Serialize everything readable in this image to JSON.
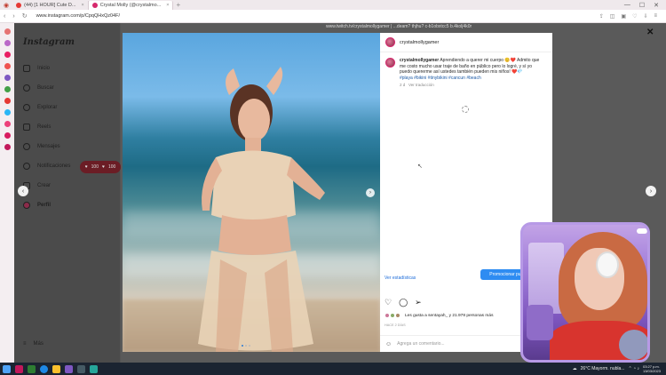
{
  "browser": {
    "tabs": [
      {
        "label": "(44) [1 HOUR] Cute D...",
        "active": false,
        "favicon_color": "#e53935"
      },
      {
        "label": "Crystal Molly (@crystalmo...",
        "active": true,
        "favicon_color": "#d6296d"
      }
    ],
    "url": "www.instagram.com/p/CpqQHxQz04F/",
    "background_text": "www.twitch.tv/crystalmollygamer | ...deam? thjhu? c-b1obxtcc5 b.4kolj4k0r"
  },
  "sidebar": {
    "logo": "Instagram",
    "items": [
      {
        "label": "Inicio",
        "icon": "home-icon",
        "bold": false
      },
      {
        "label": "Buscar",
        "icon": "search-icon",
        "bold": false
      },
      {
        "label": "Explorar",
        "icon": "compass-icon",
        "bold": false
      },
      {
        "label": "Reels",
        "icon": "reels-icon",
        "bold": false
      },
      {
        "label": "Mensajes",
        "icon": "messenger-icon",
        "bold": false
      },
      {
        "label": "Notificaciones",
        "icon": "heart-icon",
        "bold": false
      },
      {
        "label": "Crear",
        "icon": "plus-square-icon",
        "bold": false
      },
      {
        "label": "Perfil",
        "icon": "avatar-icon",
        "bold": true
      }
    ],
    "more_label": "Más",
    "notification_counts": [
      "100",
      "100"
    ]
  },
  "post": {
    "username": "crystalmollygamer",
    "caption": "Aprendiendo a querer mi cuerpo 😊❤️ Admito que me costo mucho usar traje de baño en público pero lo logré, y sí yo puedo quererme así ustedes también pueden mis niños! ❤️💎",
    "hashtags": "#playa #bikini #tinybikini #cancun #beach",
    "caption_age": "2 d",
    "translate_label": "Ver traducción",
    "stats_label": "Ver estadísticas",
    "promote_label": "Promocionar pu...",
    "likes_text": "Les gusta a sentayah_ y 21.978 personas más",
    "posted_ago": "HACE 2 DÍAS",
    "comment_placeholder": "Agrega un comentario..."
  },
  "taskbar": {
    "weather": "26°C  Mayorm. nubla...",
    "time": "03:27 p.m.",
    "date": "13/03/2023"
  },
  "colors": {
    "instagram_accent": "#d6296d",
    "link_blue": "#1c6bd9",
    "promote_blue": "#2e8cf2",
    "taskbar": "#1b2431"
  }
}
